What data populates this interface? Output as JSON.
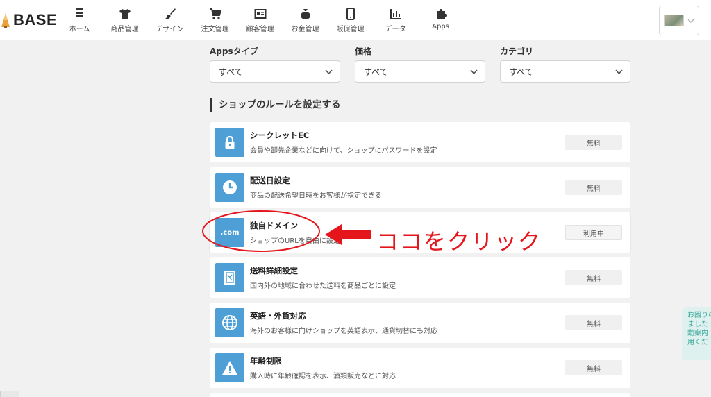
{
  "header": {
    "logo_text": "BASE",
    "nav": [
      {
        "label": "ホーム",
        "icon": "home-icon"
      },
      {
        "label": "商品管理",
        "icon": "shirt-icon"
      },
      {
        "label": "デザイン",
        "icon": "brush-icon"
      },
      {
        "label": "注文管理",
        "icon": "cart-icon"
      },
      {
        "label": "顧客管理",
        "icon": "id-card-icon"
      },
      {
        "label": "お金管理",
        "icon": "money-bag-icon"
      },
      {
        "label": "販促管理",
        "icon": "smartphone-icon"
      },
      {
        "label": "データ",
        "icon": "bar-chart-icon"
      },
      {
        "label": "Apps",
        "icon": "puzzle-icon"
      }
    ]
  },
  "filters": [
    {
      "label": "Appsタイプ",
      "value": "すべて"
    },
    {
      "label": "価格",
      "value": "すべて"
    },
    {
      "label": "カテゴリ",
      "value": "すべて"
    }
  ],
  "section": {
    "title": "ショップのルールを設定する"
  },
  "apps": [
    {
      "title": "シークレットEC",
      "desc": "会員や卸先企業などに向けて、ショップにパスワードを設定",
      "badge": "無料",
      "icon": "lock-icon"
    },
    {
      "title": "配送日設定",
      "desc": "商品の配送希望日時をお客様が指定できる",
      "badge": "無料",
      "icon": "clock-icon"
    },
    {
      "title": "独自ドメイン",
      "desc": "ショップのURLを自由に設定",
      "badge": "利用中",
      "icon": "dotcom-icon",
      "icon_text": ".com"
    },
    {
      "title": "送料詳細設定",
      "desc": "国内外の地域に合わせた送料を商品ごとに設定",
      "badge": "無料",
      "icon": "stamp-icon"
    },
    {
      "title": "英語・外貨対応",
      "desc": "海外のお客様に向けショップを英語表示、通貨切替にも対応",
      "badge": "無料",
      "icon": "globe-icon"
    },
    {
      "title": "年齢制限",
      "desc": "購入時に年齢確認を表示、酒類販売などに対応",
      "badge": "無料",
      "icon": "warning-icon"
    }
  ],
  "annotation": {
    "text": "ココをクリック",
    "color": "#e5151c"
  },
  "help": {
    "lines": [
      "お困りの",
      "ました",
      "動案内",
      "用くだ"
    ]
  },
  "colors": {
    "accent": "#4d9fd6",
    "background": "#f1f1f1"
  }
}
